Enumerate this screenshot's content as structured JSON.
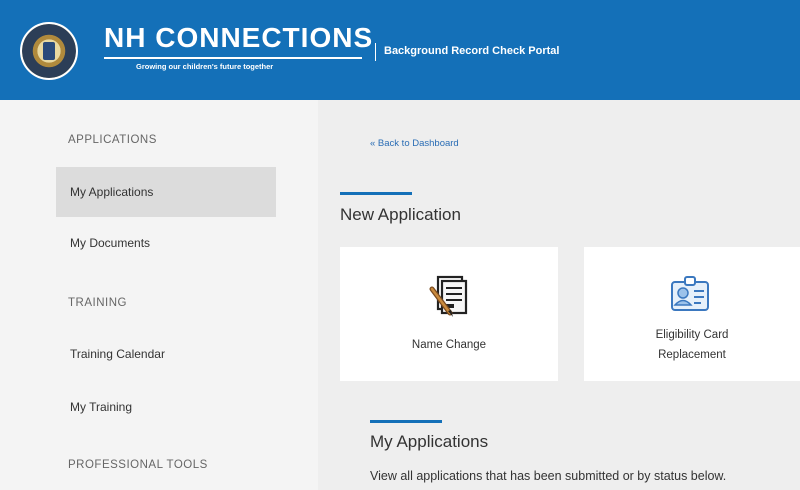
{
  "header": {
    "brand_title": "NH CONNECTIONS",
    "tagline": "Growing our children's future together",
    "portal_title": "Background Record Check Portal",
    "brand_color": "#1470b8"
  },
  "sidebar": {
    "sections": [
      {
        "heading": "APPLICATIONS",
        "items": [
          "My Applications",
          "My Documents"
        ]
      },
      {
        "heading": "TRAINING",
        "items": [
          "Training Calendar",
          "My Training"
        ]
      },
      {
        "heading": "PROFESSIONAL TOOLS",
        "items": []
      }
    ],
    "active_item": "My Applications"
  },
  "main": {
    "back_link": "« Back to Dashboard",
    "new_application": {
      "title": "New Application",
      "cards": [
        {
          "label": "Name Change",
          "icon": "document-pen-icon"
        },
        {
          "label_line1": "Eligibility Card",
          "label_line2": "Replacement",
          "icon": "id-card-icon"
        }
      ]
    },
    "my_applications": {
      "title": "My Applications",
      "description": "View all applications that has been submitted or by status below."
    }
  }
}
